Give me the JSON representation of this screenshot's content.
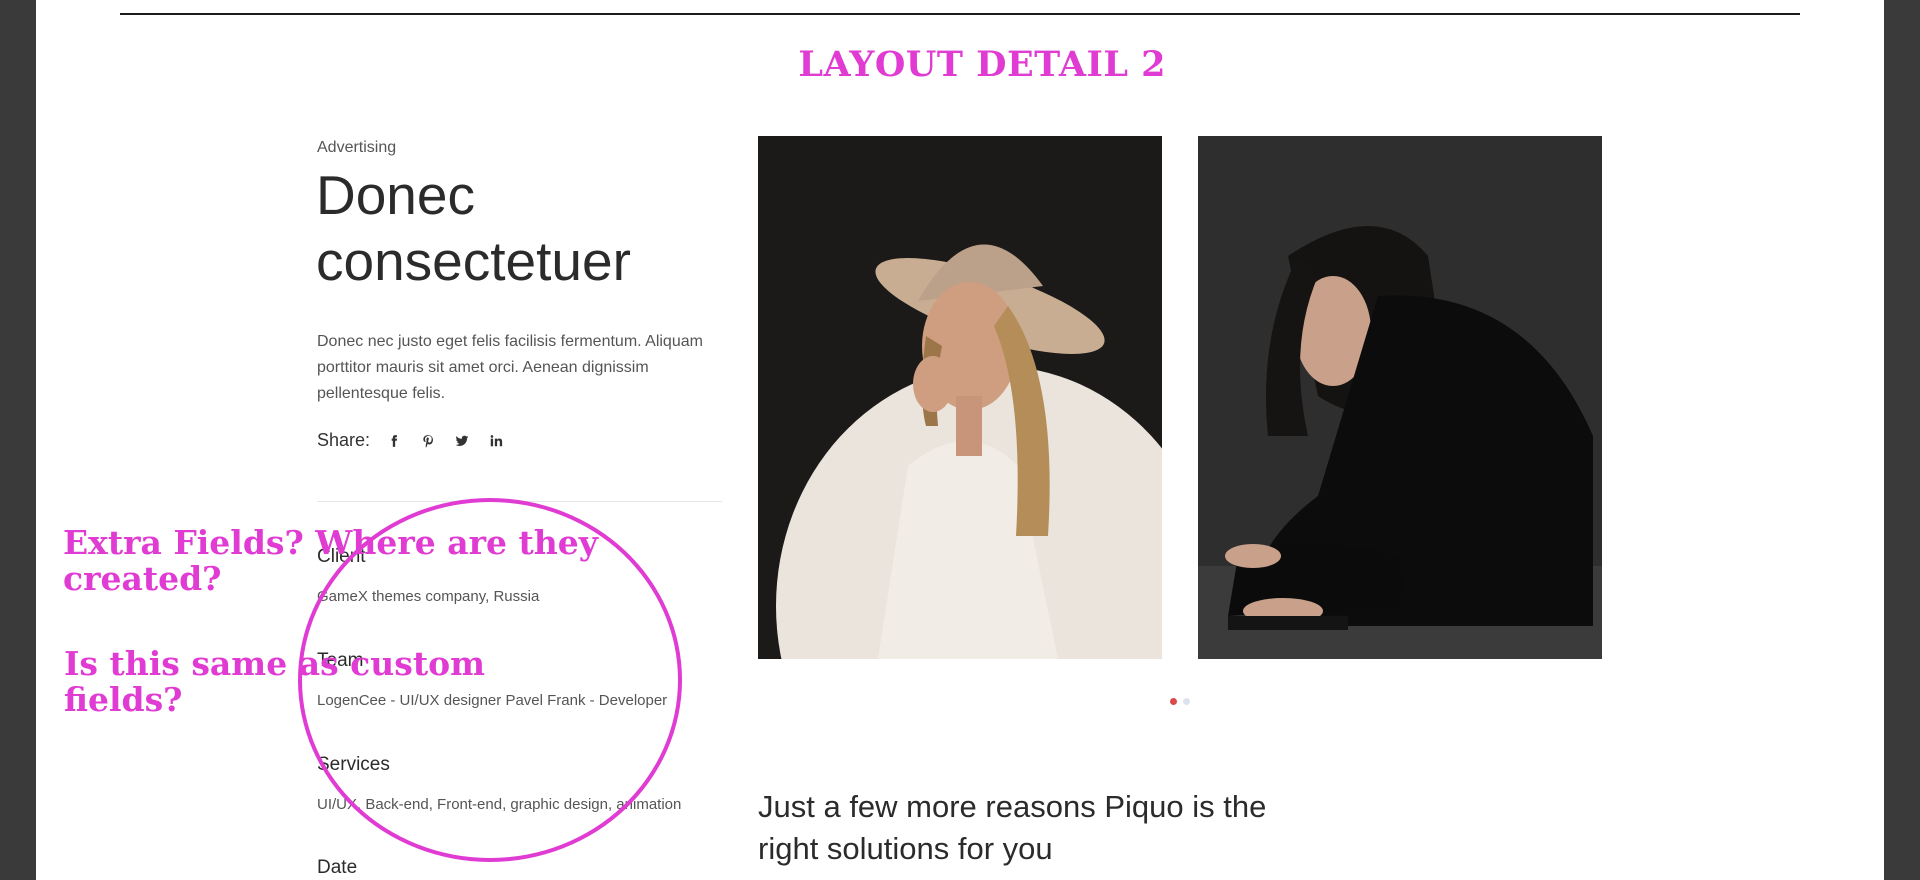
{
  "header": {
    "layout_title": "LAYOUT DETAIL 2"
  },
  "project": {
    "category": "Advertising",
    "title": "Donec consectetuer",
    "description": "Donec nec justo eget felis facilisis fermentum. Aliquam porttitor mauris sit amet orci. Aenean dignissim pellentesque felis.",
    "share_label": "Share:",
    "share_icons": [
      "facebook-icon",
      "pinterest-icon",
      "twitter-icon",
      "linkedin-icon"
    ],
    "fields": [
      {
        "label": "Client",
        "value": "GameX themes company, Russia"
      },
      {
        "label": "Team",
        "value": "LogenCee - UI/UX designer Pavel Frank - Developer"
      },
      {
        "label": "Services",
        "value": "UI/UX, Back-end, Front-end, graphic design, animation"
      },
      {
        "label": "Date",
        "value": ""
      }
    ]
  },
  "gallery": {
    "images": [
      {
        "subject": "woman-in-hat-photo"
      },
      {
        "subject": "woman-sitting-photo"
      }
    ],
    "slider": {
      "count": 2,
      "active_index": 0
    }
  },
  "section": {
    "heading": "Just a few more reasons Piquo is the right solutions for you"
  },
  "annotations": {
    "note_1": "Extra Fields? Where are they created?",
    "note_2": "Is this same as custom fields?"
  },
  "colors": {
    "annotation": "#e03bd2",
    "dot_active": "#d94a4a",
    "dot_inactive": "#dde3ec",
    "frame": "#3a3a3a"
  }
}
